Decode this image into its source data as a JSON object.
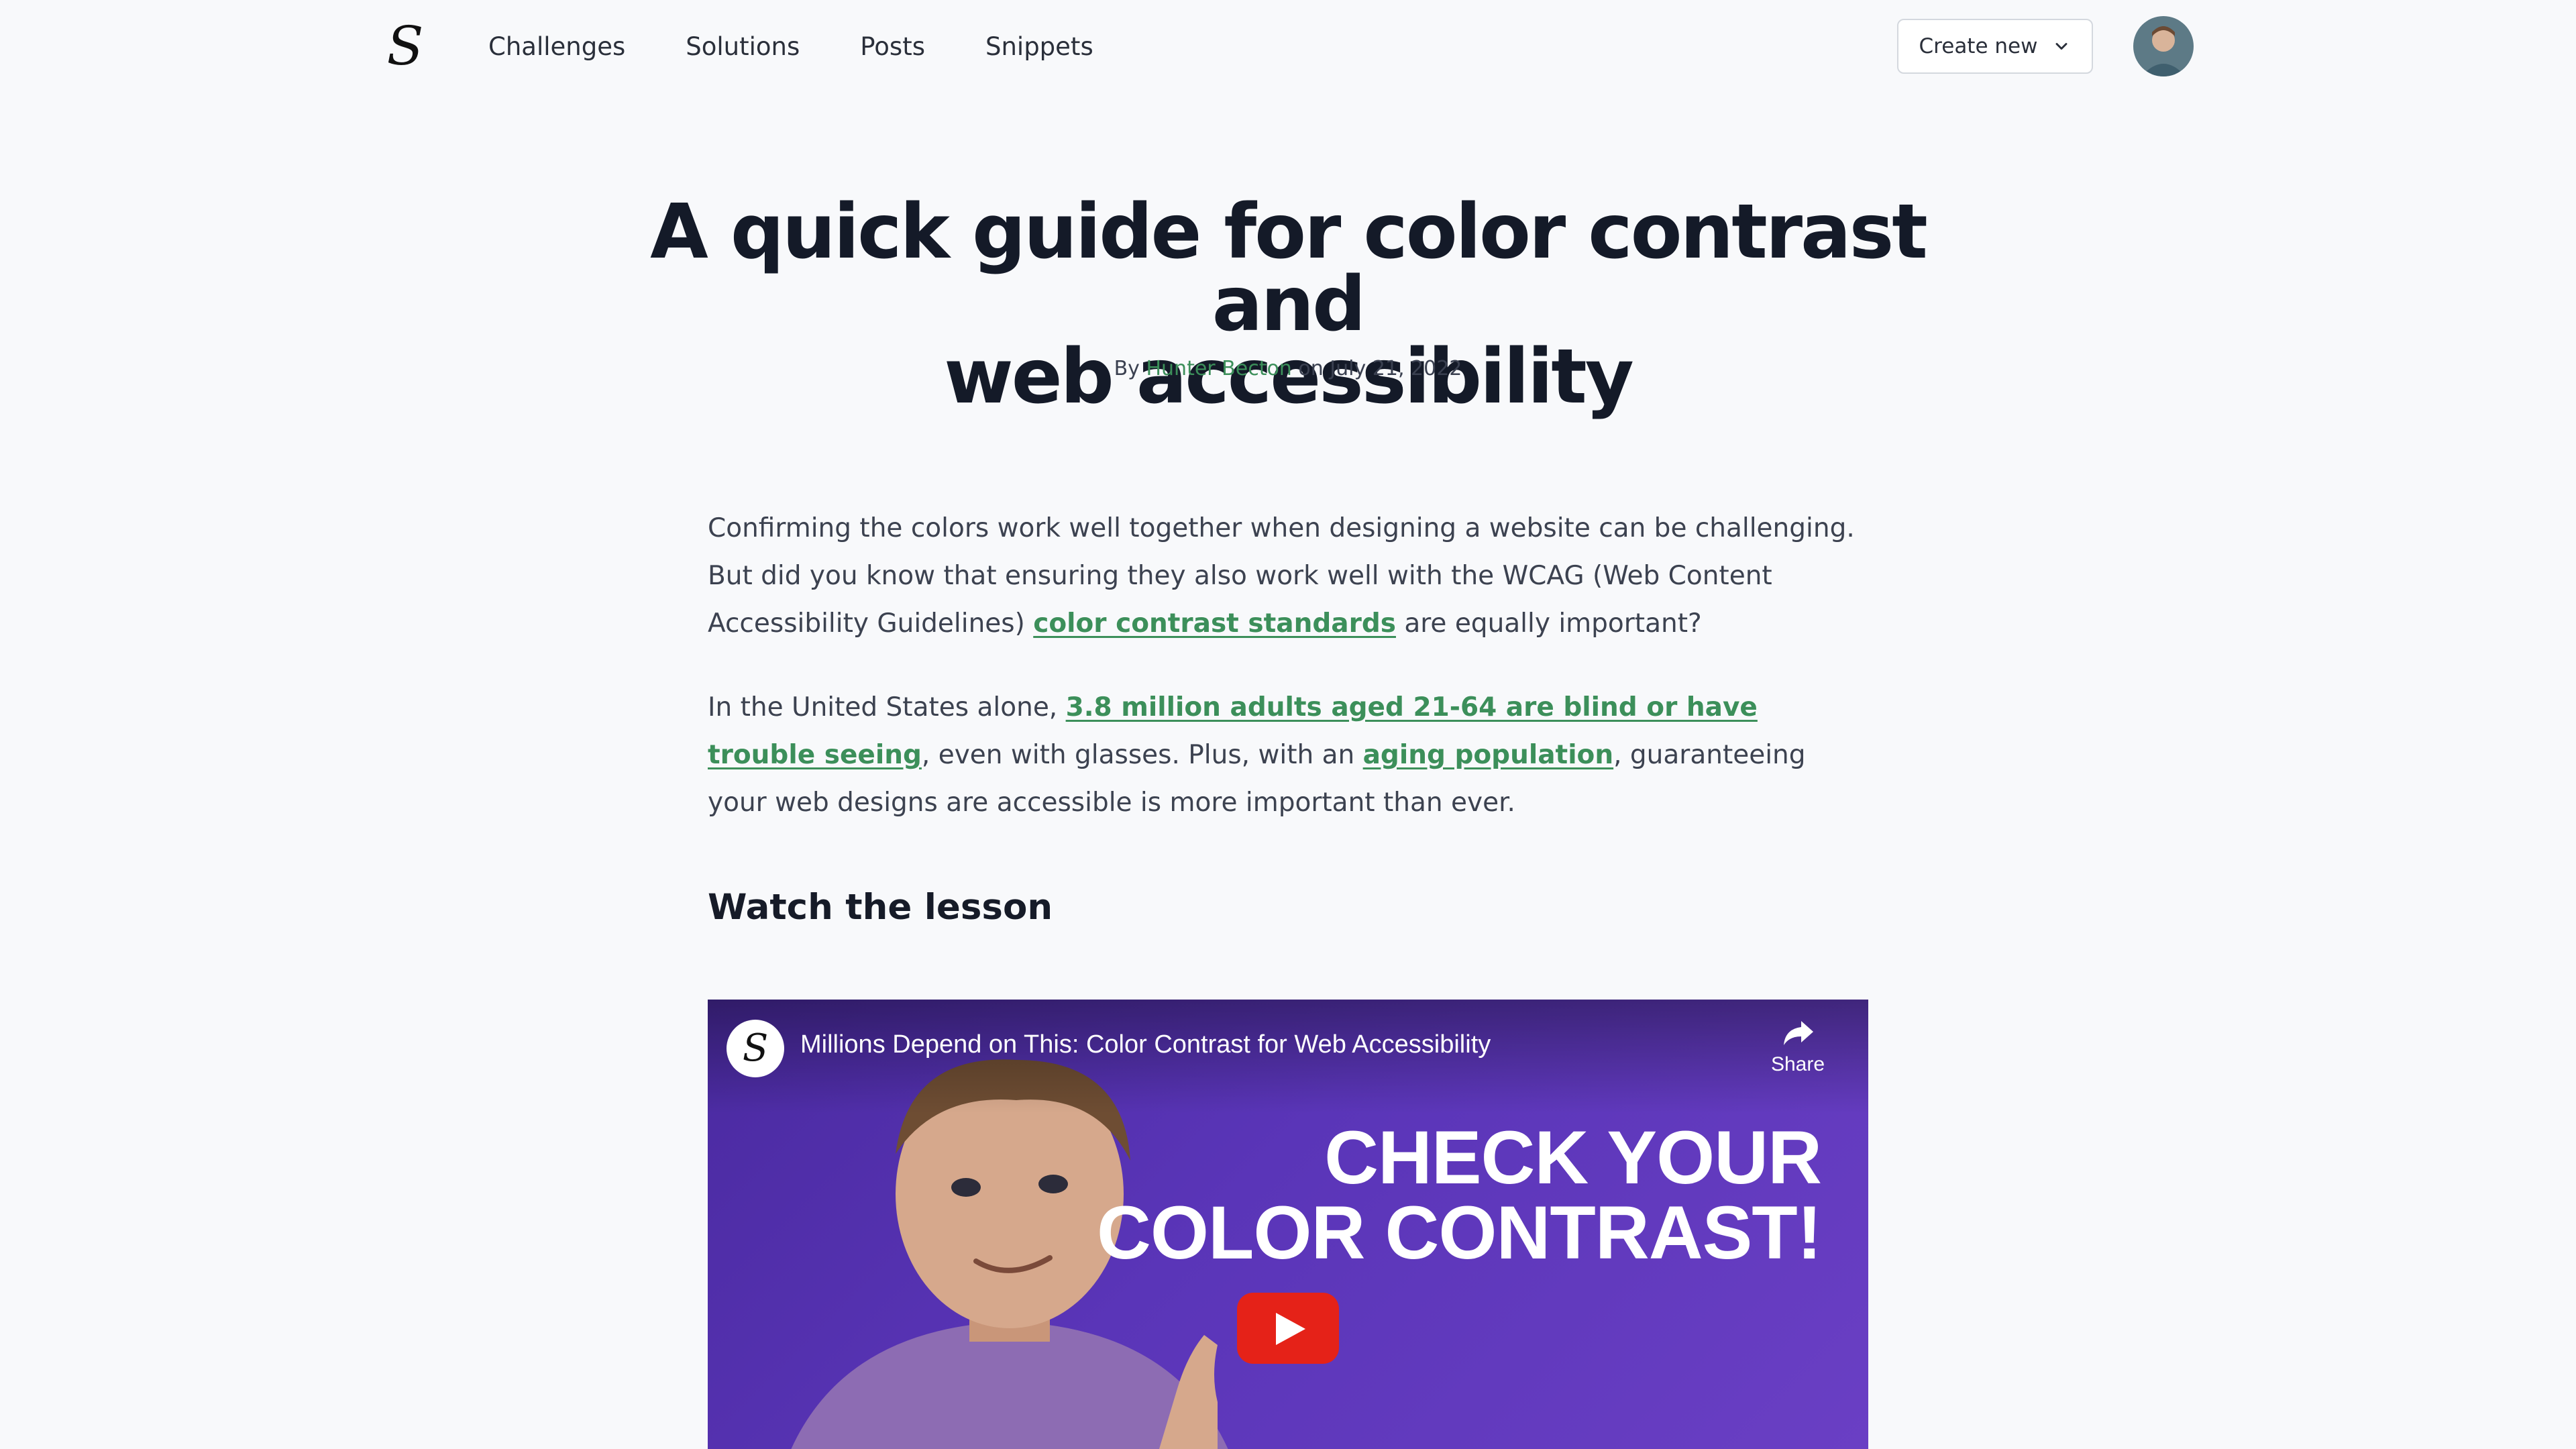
{
  "nav": {
    "logo_glyph": "S",
    "links": [
      "Challenges",
      "Solutions",
      "Posts",
      "Snippets"
    ],
    "create_label": "Create new"
  },
  "post": {
    "title_line1": "A quick guide for color contrast and",
    "title_line2": "web accessibility",
    "by": "By",
    "author": "Hunter Becton",
    "on": "on",
    "date": "July 21, 2022",
    "p1": {
      "before": "Confirming the colors work well together when designing a website can be challenging. But did you know that ensuring they also work well with the WCAG (Web Content Accessibility Guidelines) ",
      "link": "color contrast standards",
      "after": " are equally important?"
    },
    "p2": {
      "before": "In the United States alone, ",
      "link1": "3.8 million adults aged 21-64 are blind or have trouble seeing",
      "mid": ", even with glasses. Plus, with an ",
      "link2": "aging population",
      "after": ", guaranteeing your web designs are accessible is more important than ever."
    },
    "section_heading": "Watch the lesson"
  },
  "video": {
    "title": "Millions Depend on This: Color Contrast for Web Accessibility",
    "share_label": "Share",
    "thumb_line1": "CHECK YOUR",
    "thumb_line2": "COLOR CONTRAST!",
    "play_icon": "play-icon"
  },
  "colors": {
    "link": "#3c8f5a",
    "video_bg": "#5a35b8",
    "play": "#e52218"
  }
}
